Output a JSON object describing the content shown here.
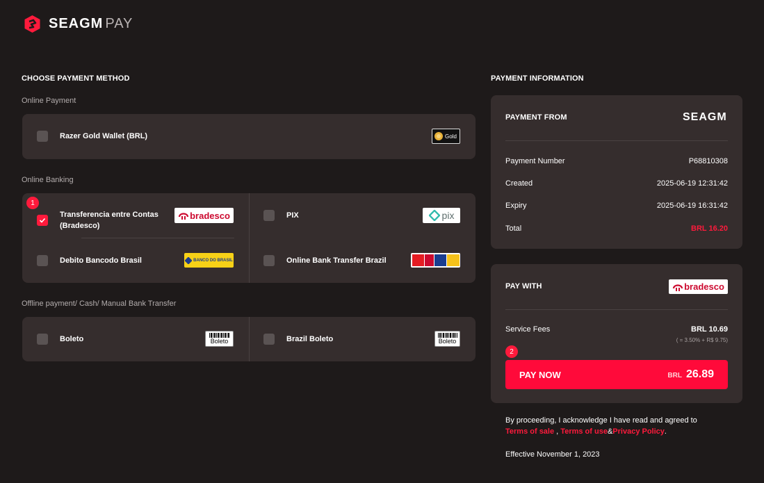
{
  "brand": {
    "name": "SEAGM",
    "suffix": "PAY",
    "accent": "#ff1a3c"
  },
  "left": {
    "title": "CHOOSE PAYMENT METHOD",
    "groups": {
      "online_payment": {
        "label": "Online Payment",
        "methods": [
          {
            "label": "Razer Gold Wallet (BRL)",
            "logo": "razer-gold-logo",
            "checked": false
          }
        ]
      },
      "online_banking": {
        "label": "Online Banking",
        "methods": [
          {
            "label_line1": "Transferencia entre Contas",
            "label_line2": "(Bradesco)",
            "logo": "bradesco-logo",
            "logo_text": "bradesco",
            "checked": true,
            "step": "1"
          },
          {
            "label": "PIX",
            "logo": "pix-logo",
            "logo_text": "pix",
            "checked": false
          },
          {
            "label": "Debito Bancodo Brasil",
            "logo": "banco-do-brasil-logo",
            "logo_text": "BANCO DO BRASIL",
            "checked": false
          },
          {
            "label": "Online Bank Transfer Brazil",
            "logo": "brazil-banks-logo",
            "checked": false
          }
        ]
      },
      "offline": {
        "label": "Offline payment/ Cash/ Manual Bank Transfer",
        "methods": [
          {
            "label": "Boleto",
            "logo": "boleto-logo",
            "logo_text": "Boleto",
            "checked": false
          },
          {
            "label": "Brazil Boleto",
            "logo": "boleto-logo",
            "logo_text": "Boleto",
            "checked": false
          }
        ]
      }
    }
  },
  "right": {
    "title": "PAYMENT INFORMATION",
    "payment_from": {
      "label": "PAYMENT FROM",
      "merchant": "SEAGM",
      "rows": [
        {
          "key": "Payment Number",
          "value": "P68810308"
        },
        {
          "key": "Created",
          "value": "2025-06-19 12:31:42"
        },
        {
          "key": "Expiry",
          "value": "2025-06-19 16:31:42"
        },
        {
          "key": "Total",
          "value": "BRL 16.20"
        }
      ]
    },
    "pay_with": {
      "label": "PAY WITH",
      "method_logo_text": "bradesco",
      "fees_label": "Service Fees",
      "fees_value": "BRL 10.69",
      "fees_detail": "( = 3.50% + R$ 9.75)",
      "step": "2",
      "button_label": "PAY NOW",
      "button_currency": "BRL",
      "button_amount": "26.89"
    },
    "legal": {
      "line1": "By proceeding, I acknowledge I have read and agreed to",
      "terms_of_sale": "Terms of sale",
      "sep1": ",",
      "terms_of_use": "Terms of use",
      "sep2": "&",
      "privacy": "Privacy Policy",
      "end": ".",
      "effective": "Effective November 1, 2023"
    }
  }
}
